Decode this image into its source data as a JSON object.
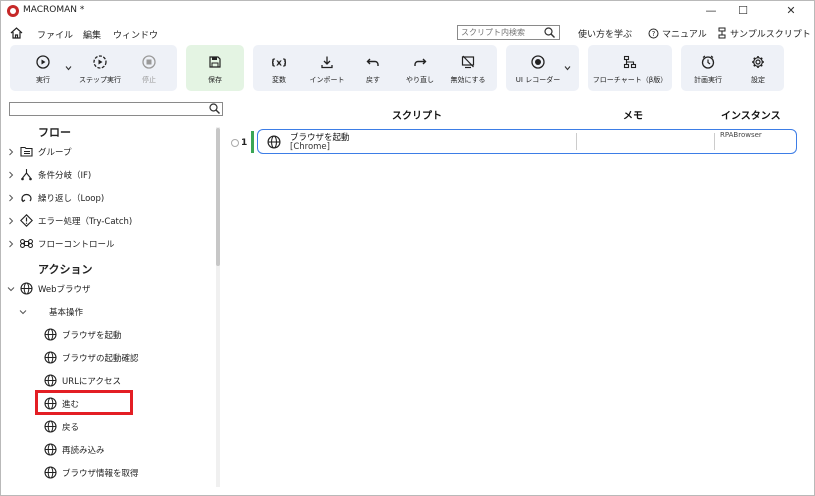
{
  "window": {
    "title": "MACROMAN *",
    "controls": {
      "minimize": "—",
      "maximize": "☐",
      "close": "✕"
    }
  },
  "menu": {
    "items": [
      "ファイル",
      "編集",
      "ウィンドウ"
    ],
    "search_placeholder": "スクリプト内検索",
    "links": {
      "learn": "使い方を学ぶ",
      "manual": "マニュアル",
      "sample": "サンプルスクリプト"
    }
  },
  "toolbar": {
    "run": "実行",
    "step_run": "ステップ実行",
    "stop": "停止",
    "save": "保存",
    "variables": "変数",
    "import": "インポート",
    "undo": "戻す",
    "redo": "やり直し",
    "disable": "無効にする",
    "ui_recorder": "UI レコーダー",
    "flowchart": "フローチャート（β版）",
    "schedule": "計画実行",
    "settings": "設定"
  },
  "left_panel": {
    "search_placeholder": "",
    "flow_header": "フロー",
    "flow_items": [
      "グループ",
      "条件分岐（IF)",
      "繰り返し（Loop)",
      "エラー処理（Try-Catch)",
      "フローコントロール"
    ],
    "action_header": "アクション",
    "web_browser": "Webブラウザ",
    "basic_ops": "基本操作",
    "actions": [
      "ブラウザを起動",
      "ブラウザの起動確認",
      "URLにアクセス",
      "進む",
      "戻る",
      "再読み込み",
      "ブラウザ情報を取得"
    ]
  },
  "script_panel": {
    "columns": {
      "script": "スクリプト",
      "memo": "メモ",
      "instance": "インスタンス"
    },
    "rows": [
      {
        "number": "1",
        "name": "ブラウザを起動",
        "param": "[Chrome]",
        "memo": "",
        "instance": "RPABrowser"
      }
    ]
  },
  "colors": {
    "accent_blue": "#3d7de6",
    "highlight_red": "#e31e24",
    "row_marker_green": "#3aa655",
    "save_group_green": "#e4f4e3",
    "toolbar_group": "#eef1f7"
  }
}
